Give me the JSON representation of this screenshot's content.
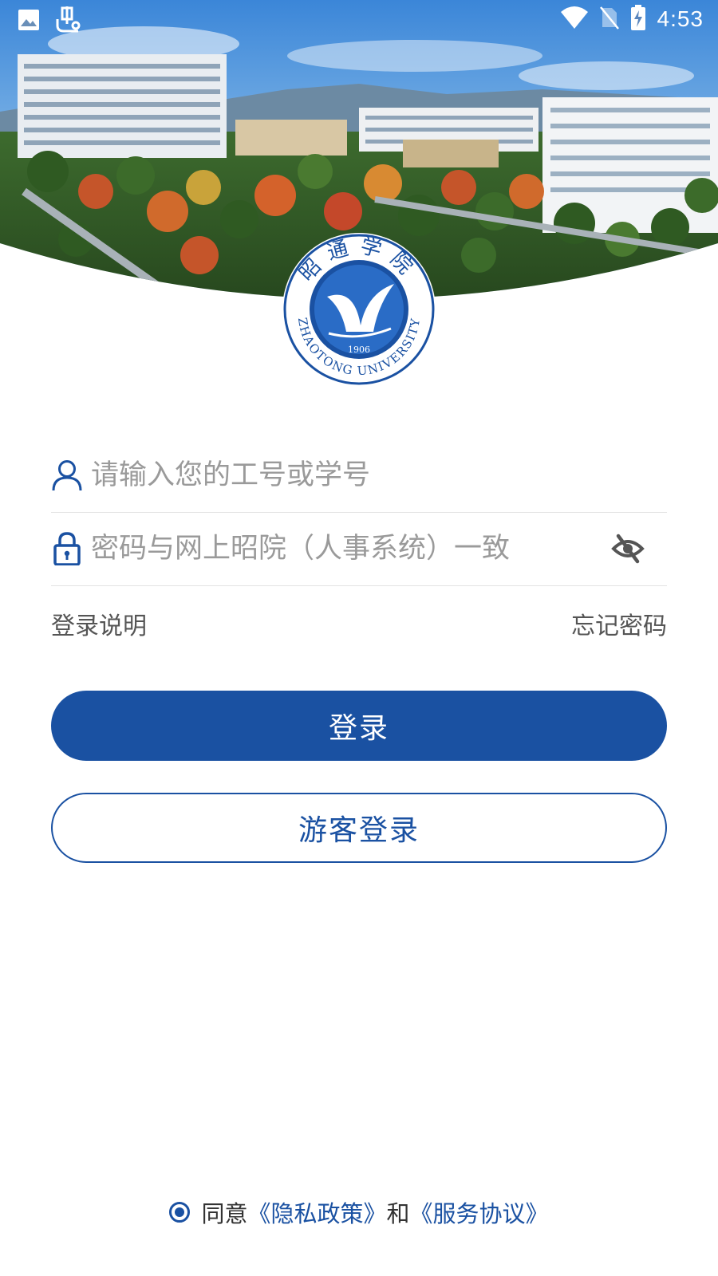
{
  "status_bar": {
    "time": "4:53",
    "left_icons": [
      "image-icon",
      "bug-icon"
    ],
    "right_icons": [
      "wifi-icon",
      "no-sim-icon",
      "battery-charging-icon"
    ]
  },
  "header": {
    "image": "campus-photo",
    "logo": {
      "seal_chars": "昭通学院",
      "english": "ZHAOTONG UNIVERSITY",
      "year": "1906"
    }
  },
  "login_form": {
    "username_placeholder": "请输入您的工号或学号",
    "password_placeholder": "密码与网上昭院（人事系统）一致"
  },
  "links": {
    "login_help": "登录说明",
    "forgot_password": "忘记密码"
  },
  "buttons": {
    "login": "登录",
    "guest_login": "游客登录"
  },
  "agreement": {
    "agree": "同意",
    "privacy": "《隐私政策》",
    "and": "和",
    "service": "《服务协议》"
  },
  "colors": {
    "accent": "#1a51a2",
    "placeholder": "#9a9a9a",
    "divider": "#e3e3e3"
  }
}
